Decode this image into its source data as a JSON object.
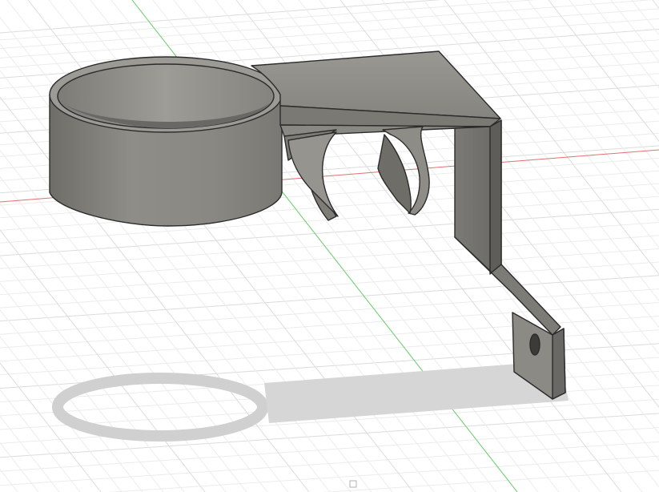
{
  "viewport": {
    "background": "#ffffff",
    "grid_color": "#dcdcdc",
    "grid_minor_color": "#ececec",
    "x_axis_color": "#e06060",
    "y_axis_color": "#5ccc5c",
    "model": {
      "body_color": "#8c8a84",
      "highlight_color": "#a8a6a0",
      "shade_color": "#6e6c67",
      "edge_color": "#2a2a2a",
      "shadow_color": "#d2d2d2"
    }
  }
}
